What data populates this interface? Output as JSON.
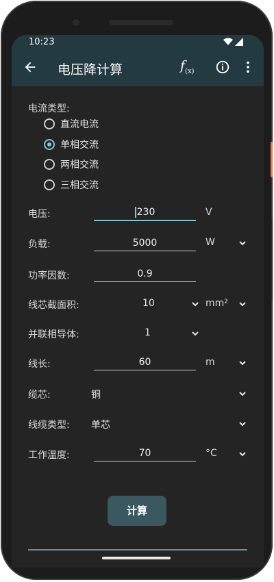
{
  "status": {
    "time": "10:23"
  },
  "appbar": {
    "title": "电压降计算",
    "fx_label": "f",
    "fx_sub": "(x)"
  },
  "current_type": {
    "label": "电流类型:",
    "options": [
      "直流电流",
      "单相交流",
      "两相交流",
      "三相交流"
    ],
    "selected": "单相交流"
  },
  "fields": {
    "voltage": {
      "label": "电压:",
      "value": "230",
      "unit": "V"
    },
    "load": {
      "label": "负载:",
      "value": "5000",
      "unit": "W"
    },
    "power_factor": {
      "label": "功率因数:",
      "value": "0.9"
    },
    "cross_section": {
      "label": "线芯截面积:",
      "value": "10",
      "unit": "mm²"
    },
    "parallel": {
      "label": "并联相导体:",
      "value": "1"
    },
    "length": {
      "label": "线长:",
      "value": "60",
      "unit": "m"
    },
    "core": {
      "label": "缆芯:",
      "value": "铜"
    },
    "cable_type": {
      "label": "线缆类型:",
      "value": "单芯"
    },
    "temperature": {
      "label": "工作温度:",
      "value": "70",
      "unit": "°C"
    }
  },
  "actions": {
    "calculate": "计算"
  },
  "colors": {
    "appbar": "#233a41",
    "accent": "#86c6cf",
    "background": "#242424",
    "button": "#3b5861"
  }
}
